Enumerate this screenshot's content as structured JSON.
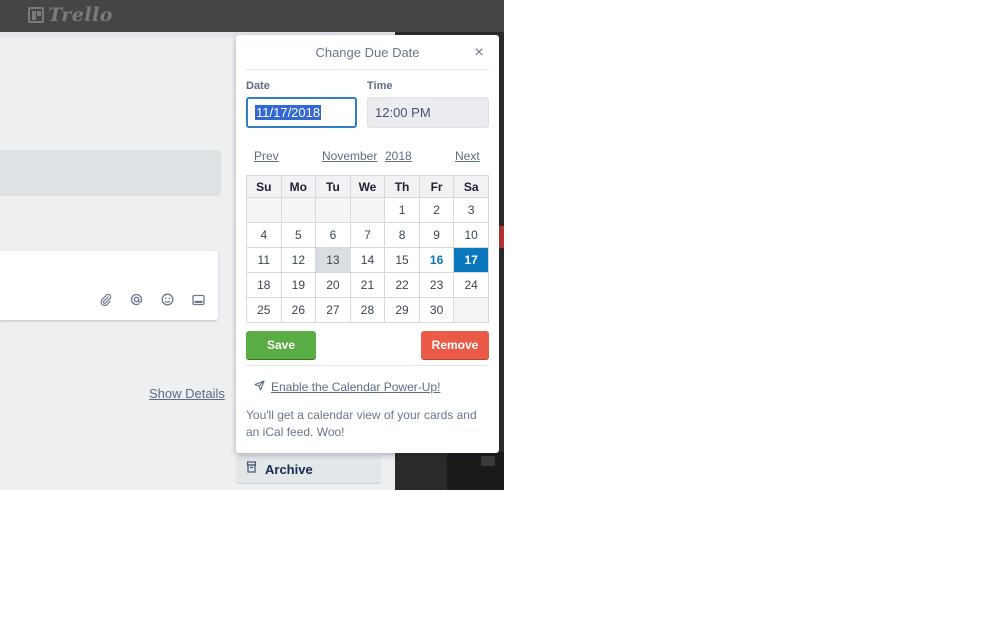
{
  "app": {
    "logo_text": "Trello",
    "show_details_label": "Show Details",
    "archive_label": "Archive"
  },
  "popover": {
    "title": "Change Due Date",
    "close_glyph": "×",
    "date_label": "Date",
    "date_value": "11/17/2018",
    "time_label": "Time",
    "time_value": "12:00 PM",
    "nav": {
      "prev": "Prev",
      "month": "November",
      "year": "2018",
      "next": "Next"
    },
    "weekdays": [
      "Su",
      "Mo",
      "Tu",
      "We",
      "Th",
      "Fr",
      "Sa"
    ],
    "weeks": [
      [
        "",
        "",
        "",
        "",
        "1",
        "2",
        "3"
      ],
      [
        "4",
        "5",
        "6",
        "7",
        "8",
        "9",
        "10"
      ],
      [
        "11",
        "12",
        "13",
        "14",
        "15",
        "16",
        "17"
      ],
      [
        "18",
        "19",
        "20",
        "21",
        "22",
        "23",
        "24"
      ],
      [
        "25",
        "26",
        "27",
        "28",
        "29",
        "30",
        ""
      ]
    ],
    "today_day": "13",
    "due_day": "16",
    "selected_day": "17",
    "save_label": "Save",
    "remove_label": "Remove",
    "powerup_link": "Enable the Calendar Power-Up!",
    "powerup_desc": "You'll get a calendar view of your cards and an iCal feed. Woo!"
  },
  "colors": {
    "save": "#5aac44",
    "remove": "#eb5a46",
    "selected": "#0b77bd",
    "topbar": "#454545"
  },
  "icons": {
    "logo": "trello-board-icon",
    "close": "close-icon",
    "attach": "paperclip-icon",
    "mention": "at-icon",
    "emoji": "smiley-icon",
    "card": "card-icon",
    "powerup": "rocket-icon",
    "archive": "archive-box-icon"
  }
}
